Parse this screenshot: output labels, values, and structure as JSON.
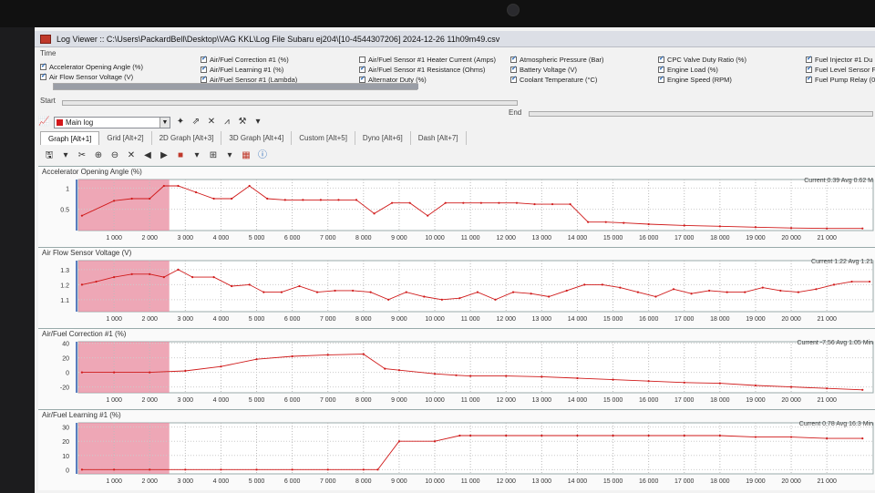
{
  "window": {
    "title": "Log Viewer :: C:\\Users\\PackardBell\\Desktop\\VAG KKL\\Log File Subaru ej204\\[10-4544307206] 2024-12-26 11h09m49.csv"
  },
  "labels": {
    "time": "Time",
    "start": "Start",
    "end": "End"
  },
  "parameters": [
    {
      "label": "Accelerator Opening Angle (%)",
      "checked": true
    },
    {
      "label": "Air Flow Sensor Voltage (V)",
      "checked": true
    },
    {
      "label": "Air/Fuel Correction #1 (%)",
      "checked": true
    },
    {
      "label": "Air/Fuel Learning #1 (%)",
      "checked": true
    },
    {
      "label": "Air/Fuel Sensor #1 (Lambda)",
      "checked": true
    },
    {
      "label": "Air/Fuel Sensor #1 Heater Current (Amps)",
      "checked": false
    },
    {
      "label": "Air/Fuel Sensor #1 Resistance (Ohms)",
      "checked": true
    },
    {
      "label": "Alternator Duty (%)",
      "checked": true
    },
    {
      "label": "Atmospheric Pressure (Bar)",
      "checked": true
    },
    {
      "label": "Battery Voltage (V)",
      "checked": true
    },
    {
      "label": "Coolant Temperature (°C)",
      "checked": true
    },
    {
      "label": "CPC Valve Duty Ratio (%)",
      "checked": true
    },
    {
      "label": "Engine Load (%)",
      "checked": true
    },
    {
      "label": "Engine Speed (RPM)",
      "checked": true
    },
    {
      "label": "Fuel Injector #1 Du",
      "checked": true
    },
    {
      "label": "Fuel Level Sensor F",
      "checked": true
    },
    {
      "label": "Fuel Pump Relay (0",
      "checked": true
    }
  ],
  "log_selector": {
    "value": "Main log"
  },
  "tabs": [
    "Graph [Alt+1]",
    "Grid [Alt+2]",
    "2D Graph [Alt+3]",
    "3D Graph [Alt+4]",
    "Custom [Alt+5]",
    "Dyno [Alt+6]",
    "Dash [Alt+7]"
  ],
  "colors": {
    "series": "#d01a1a",
    "highlight": "#e88a9d",
    "axis": "#5a7dbf"
  },
  "x_ticks": [
    "1 000",
    "2 000",
    "3 000",
    "4 000",
    "5 000",
    "6 000",
    "7 000",
    "8 000",
    "9 000",
    "10 000",
    "11 000",
    "12 000",
    "13 000",
    "14 000",
    "15 000",
    "16 000",
    "17 000",
    "18 000",
    "19 000",
    "20 000",
    "21 000"
  ],
  "chart_data": [
    {
      "type": "line",
      "title": "Accelerator Opening Angle (%)",
      "stat": "Current 0.39 Avg 0.62 M",
      "y_ticks": [
        "1",
        "0.5"
      ],
      "ylim": [
        0,
        1.2
      ],
      "x": [
        100,
        1000,
        1500,
        2000,
        2400,
        2800,
        3300,
        3800,
        4300,
        4800,
        5300,
        5800,
        6300,
        6800,
        7300,
        7800,
        8300,
        8800,
        9300,
        9800,
        10300,
        10800,
        11300,
        11800,
        12300,
        12800,
        13300,
        13800,
        14300,
        14800,
        15300,
        16000,
        17000,
        18000,
        19000,
        20000,
        21000,
        22000
      ],
      "y": [
        0.35,
        0.7,
        0.75,
        0.75,
        1.05,
        1.05,
        0.9,
        0.75,
        0.75,
        1.05,
        0.75,
        0.72,
        0.72,
        0.72,
        0.72,
        0.72,
        0.4,
        0.65,
        0.65,
        0.35,
        0.65,
        0.65,
        0.65,
        0.65,
        0.65,
        0.62,
        0.62,
        0.62,
        0.2,
        0.2,
        0.18,
        0.15,
        0.12,
        0.1,
        0.08,
        0.06,
        0.05,
        0.05
      ]
    },
    {
      "type": "line",
      "title": "Air Flow Sensor Voltage (V)",
      "stat": "Current 1.22 Avg 1.21",
      "y_ticks": [
        "1.3",
        "1.2",
        "1.1"
      ],
      "ylim": [
        1.02,
        1.36
      ],
      "x": [
        100,
        500,
        1000,
        1500,
        2000,
        2400,
        2800,
        3200,
        3800,
        4300,
        4800,
        5200,
        5700,
        6200,
        6700,
        7200,
        7700,
        8200,
        8700,
        9200,
        9700,
        10200,
        10700,
        11200,
        11700,
        12200,
        12700,
        13200,
        13700,
        14200,
        14700,
        15200,
        15700,
        16200,
        16700,
        17200,
        17700,
        18200,
        18700,
        19200,
        19700,
        20200,
        20700,
        21200,
        21700,
        22200
      ],
      "y": [
        1.2,
        1.22,
        1.25,
        1.27,
        1.27,
        1.25,
        1.3,
        1.25,
        1.25,
        1.19,
        1.2,
        1.15,
        1.15,
        1.19,
        1.15,
        1.16,
        1.16,
        1.15,
        1.1,
        1.15,
        1.12,
        1.1,
        1.11,
        1.15,
        1.1,
        1.15,
        1.14,
        1.12,
        1.16,
        1.2,
        1.2,
        1.18,
        1.15,
        1.12,
        1.17,
        1.14,
        1.16,
        1.15,
        1.15,
        1.18,
        1.16,
        1.15,
        1.17,
        1.2,
        1.22,
        1.22
      ]
    },
    {
      "type": "line",
      "title": "Air/Fuel Correction #1 (%)",
      "stat": "Current -7.56 Avg 1.05 Min",
      "y_ticks": [
        "40",
        "20",
        "0",
        "-20"
      ],
      "ylim": [
        -28,
        42
      ],
      "x": [
        100,
        1000,
        2000,
        3000,
        4000,
        5000,
        6000,
        7000,
        8000,
        8600,
        9000,
        10000,
        10600,
        11000,
        12000,
        13000,
        14000,
        15000,
        16000,
        17000,
        18000,
        19000,
        20000,
        21000,
        22000
      ],
      "y": [
        0,
        0,
        0,
        2,
        8,
        18,
        22,
        24,
        25,
        5,
        3,
        -2,
        -4,
        -5,
        -5,
        -6,
        -8,
        -10,
        -12,
        -14,
        -15,
        -18,
        -20,
        -22,
        -24
      ]
    },
    {
      "type": "line",
      "title": "Air/Fuel Learning #1 (%)",
      "stat": "Current 0.78 Avg 16.3 Min",
      "y_ticks": [
        "30",
        "20",
        "10",
        "0"
      ],
      "ylim": [
        -3,
        33
      ],
      "x": [
        100,
        1000,
        2000,
        3000,
        4000,
        5000,
        6000,
        7000,
        8000,
        8400,
        9000,
        10000,
        10700,
        11000,
        12000,
        13000,
        14000,
        15000,
        16000,
        17000,
        18000,
        19000,
        20000,
        21000,
        22000
      ],
      "y": [
        0,
        0,
        0,
        0,
        0,
        0,
        0,
        0,
        0,
        0,
        20,
        20,
        24,
        24,
        24,
        24,
        24,
        24,
        24,
        24,
        24,
        23,
        23,
        22,
        22
      ]
    }
  ]
}
